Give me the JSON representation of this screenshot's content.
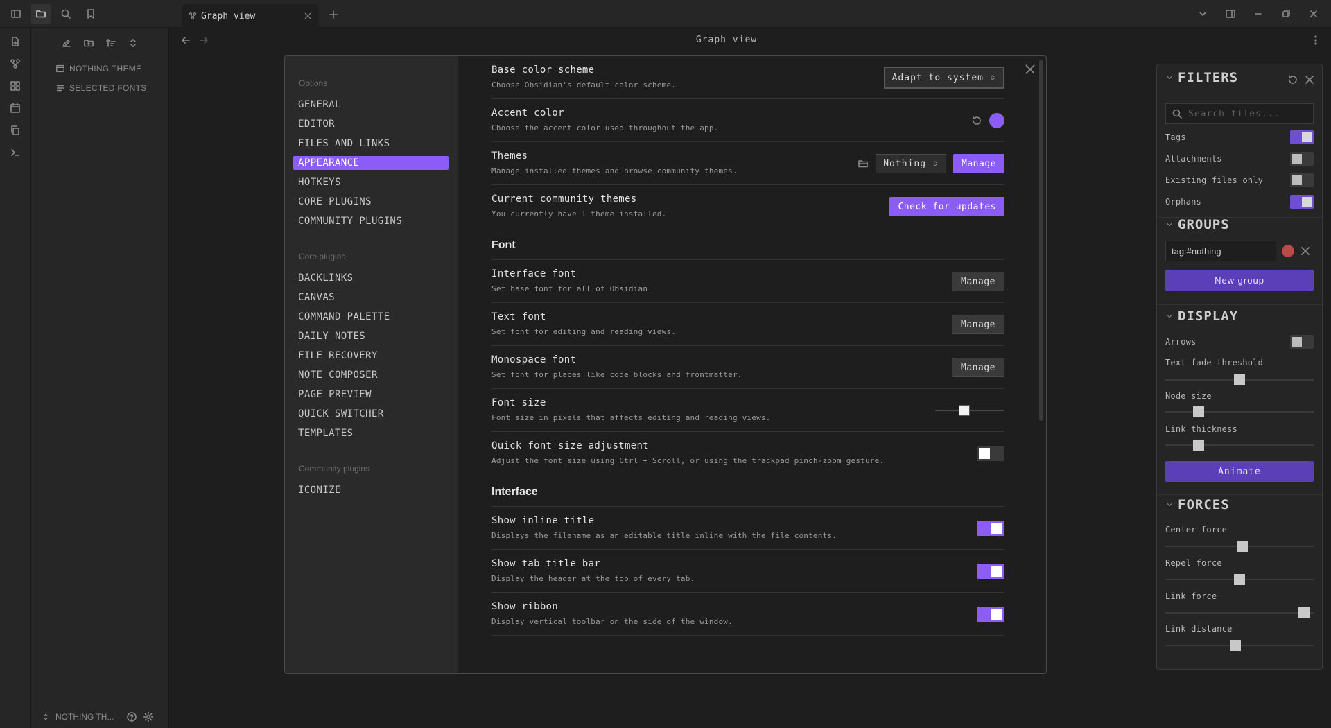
{
  "tab": {
    "title": "Graph view"
  },
  "sidebar": {
    "items": [
      {
        "label": "NOTHING THEME"
      },
      {
        "label": "SELECTED FONTS"
      }
    ],
    "vault_name": "NOTHING TH..."
  },
  "main": {
    "view_title": "Graph view"
  },
  "modal": {
    "nav": {
      "options_head": "Options",
      "options": [
        "GENERAL",
        "EDITOR",
        "FILES AND LINKS",
        "APPEARANCE",
        "HOTKEYS",
        "CORE PLUGINS",
        "COMMUNITY PLUGINS"
      ],
      "core_head": "Core plugins",
      "core": [
        "BACKLINKS",
        "CANVAS",
        "COMMAND PALETTE",
        "DAILY NOTES",
        "FILE RECOVERY",
        "NOTE COMPOSER",
        "PAGE PREVIEW",
        "QUICK SWITCHER",
        "TEMPLATES"
      ],
      "community_head": "Community plugins",
      "community": [
        "ICONIZE"
      ],
      "active": "APPEARANCE"
    },
    "settings": {
      "base_color": {
        "name": "Base color scheme",
        "desc": "Choose Obsidian's default color scheme.",
        "value": "Adapt to system"
      },
      "accent": {
        "name": "Accent color",
        "desc": "Choose the accent color used throughout the app.",
        "color": "#8b5cf6"
      },
      "themes": {
        "name": "Themes",
        "desc": "Manage installed themes and browse community themes.",
        "value": "Nothing",
        "button": "Manage"
      },
      "community_themes": {
        "name": "Current community themes",
        "desc": "You currently have 1 theme installed.",
        "button": "Check for updates"
      },
      "font_head": "Font",
      "interface_font": {
        "name": "Interface font",
        "desc": "Set base font for all of Obsidian.",
        "button": "Manage"
      },
      "text_font": {
        "name": "Text font",
        "desc": "Set font for editing and reading views.",
        "button": "Manage"
      },
      "mono_font": {
        "name": "Monospace font",
        "desc": "Set font for places like code blocks and frontmatter.",
        "button": "Manage"
      },
      "font_size": {
        "name": "Font size",
        "desc": "Font size in pixels that affects editing and reading views.",
        "value": 0.4
      },
      "quick_font": {
        "name": "Quick font size adjustment",
        "desc": "Adjust the font size using Ctrl + Scroll, or using the trackpad pinch-zoom gesture.",
        "on": false
      },
      "interface_head": "Interface",
      "inline_title": {
        "name": "Show inline title",
        "desc": "Displays the filename as an editable title inline with the file contents.",
        "on": true
      },
      "tab_title_bar": {
        "name": "Show tab title bar",
        "desc": "Display the header at the top of every tab.",
        "on": true
      },
      "ribbon": {
        "name": "Show ribbon",
        "desc": "Display vertical toolbar on the side of the window.",
        "on": true
      }
    }
  },
  "graph": {
    "filters": {
      "title": "FILTERS",
      "search_placeholder": "Search files...",
      "tags": {
        "label": "Tags",
        "on": true
      },
      "attachments": {
        "label": "Attachments",
        "on": false
      },
      "existing": {
        "label": "Existing files only",
        "on": false
      },
      "orphans": {
        "label": "Orphans",
        "on": true
      }
    },
    "groups": {
      "title": "GROUPS",
      "query": "tag:#nothing",
      "color": "#b94a4a",
      "new_group": "New group"
    },
    "display": {
      "title": "DISPLAY",
      "arrows": {
        "label": "Arrows",
        "on": false
      },
      "text_fade": {
        "label": "Text fade threshold",
        "value": 0.5
      },
      "node_size": {
        "label": "Node size",
        "value": 0.2
      },
      "link_thickness": {
        "label": "Link thickness",
        "value": 0.2
      },
      "animate": "Animate"
    },
    "forces": {
      "title": "FORCES",
      "center": {
        "label": "Center force",
        "value": 0.52
      },
      "repel": {
        "label": "Repel force",
        "value": 0.5
      },
      "link": {
        "label": "Link force",
        "value": 0.97
      },
      "distance": {
        "label": "Link distance",
        "value": 0.47
      }
    }
  }
}
